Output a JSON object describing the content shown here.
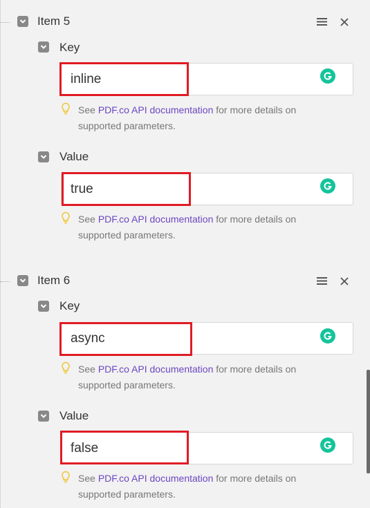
{
  "items": [
    {
      "title": "Item 5",
      "fields": [
        {
          "label": "Key",
          "value": "inline"
        },
        {
          "label": "Value",
          "value": "true"
        }
      ]
    },
    {
      "title": "Item 6",
      "fields": [
        {
          "label": "Key",
          "value": "async"
        },
        {
          "label": "Value",
          "value": "false"
        }
      ]
    }
  ],
  "hint": {
    "prefix": "See ",
    "link": "PDF.co API documentation",
    "suffix": " for more details on supported parameters."
  },
  "icons": {
    "collapse": "chevron-down-icon",
    "reorder": "menu-icon",
    "remove": "close-icon",
    "grammarly": "grammarly-icon",
    "hint": "lightbulb-icon"
  },
  "colors": {
    "highlight": "#e01b24",
    "link": "#6b46c1",
    "grammarly": "#15c39a",
    "hint_icon": "#f0c431"
  }
}
